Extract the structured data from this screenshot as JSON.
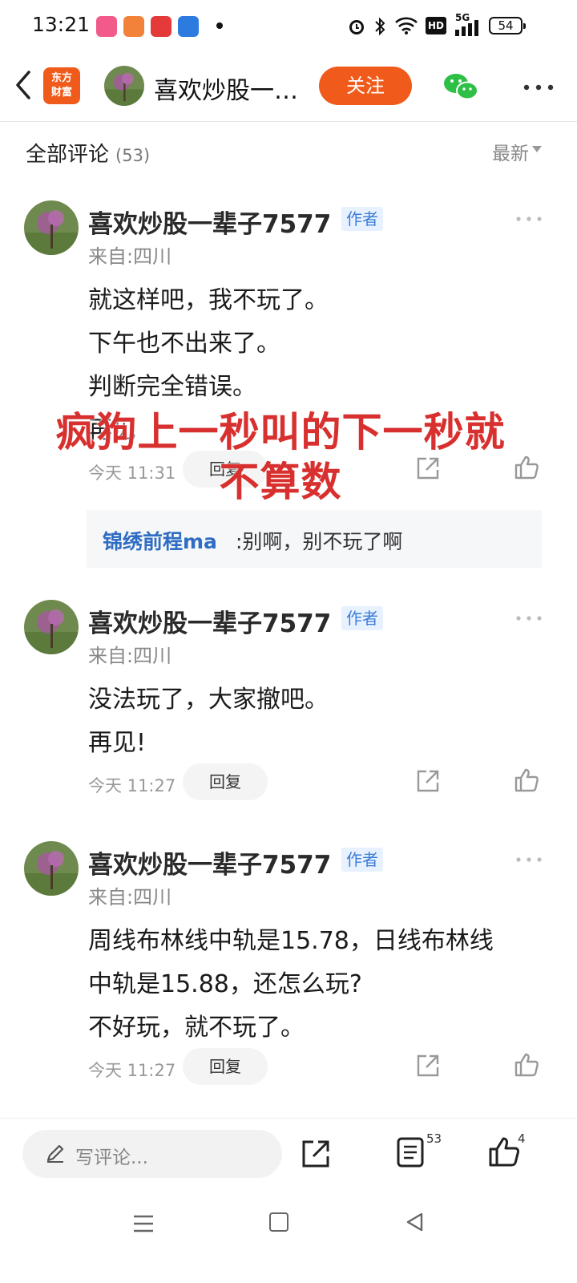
{
  "status_bar": {
    "time": "13:21",
    "network": "5G",
    "hd": "HD",
    "battery": "54"
  },
  "header": {
    "brand": "东方\n财富",
    "title": "喜欢炒股一…",
    "follow_label": "关注"
  },
  "list": {
    "title": "全部评论",
    "count": "(53)",
    "sort_label": "最新"
  },
  "overlay_text": {
    "line1": "疯狗上一秒叫的下一秒就",
    "line2": "不算数"
  },
  "comments": [
    {
      "name": "喜欢炒股一辈子7577",
      "badge": "作者",
      "location": "来自:四川",
      "lines": [
        "就这样吧，我不玩了。",
        "下午也不出来了。",
        "判断完全错误。",
        "再见"
      ],
      "time": "今天 11:31",
      "reply_label": "回复",
      "sub_reply": {
        "name": "锦绣前程ma",
        "text": ":别啊，别不玩了啊"
      }
    },
    {
      "name": "喜欢炒股一辈子7577",
      "badge": "作者",
      "location": "来自:四川",
      "lines": [
        "没法玩了，大家撤吧。",
        "再见!"
      ],
      "time": "今天 11:27",
      "reply_label": "回复"
    },
    {
      "name": "喜欢炒股一辈子7577",
      "badge": "作者",
      "location": "来自:四川",
      "lines": [
        "周线布林线中轨是15.78，日线布林线",
        "中轨是15.88，还怎么玩?",
        "不好玩，就不玩了。"
      ],
      "time": "今天 11:27",
      "reply_label": "回复"
    }
  ],
  "bottom_bar": {
    "write_placeholder": "写评论...",
    "comment_count": "53",
    "like_count": "4"
  },
  "colors": {
    "accent": "#f05a1a",
    "author_badge": "#3b7cd6",
    "overlay": "#d7302e"
  }
}
